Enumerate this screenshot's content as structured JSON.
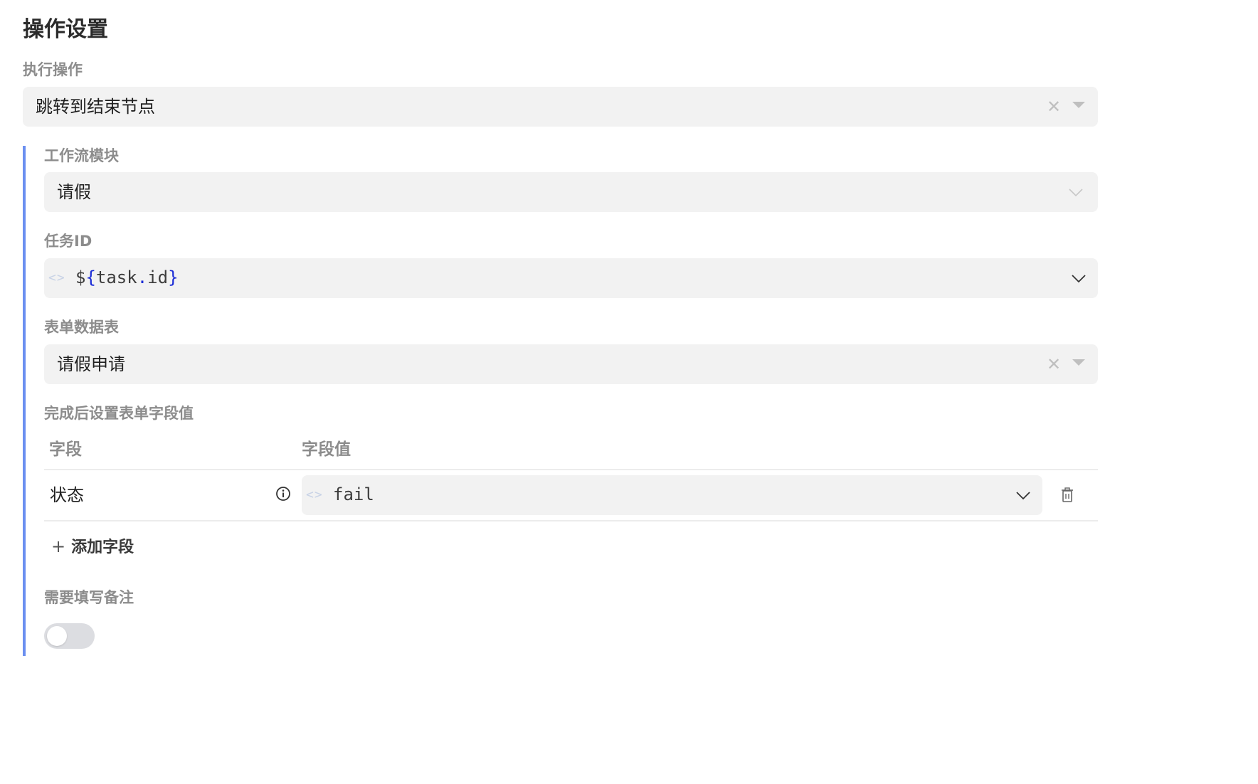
{
  "page_title": "操作设置",
  "action": {
    "label": "执行操作",
    "value": "跳转到结束节点",
    "clear_icon": "close-icon",
    "caret_icon": "caret-down-icon"
  },
  "workflow_module": {
    "label": "工作流模块",
    "value": "请假",
    "chevron_icon": "chevron-down-icon"
  },
  "task_id": {
    "label": "任务ID",
    "prefix_icon": "code-icon",
    "expression": {
      "dollar": "$",
      "open_brace": "{",
      "object": "task",
      "dot": ".",
      "property": "id",
      "close_brace": "}"
    },
    "chevron_icon": "chevron-down-icon"
  },
  "form_table": {
    "label": "表单数据表",
    "value": "请假申请",
    "clear_icon": "close-icon",
    "caret_icon": "caret-down-icon"
  },
  "field_values": {
    "label": "完成后设置表单字段值",
    "columns": [
      "字段",
      "字段值"
    ],
    "rows": [
      {
        "field": "状态",
        "info_icon": "info-icon",
        "value": "fail",
        "value_icon": "code-icon",
        "delete_icon": "trash-icon"
      }
    ],
    "add_label": "添加字段",
    "add_icon": "plus-icon"
  },
  "require_remark": {
    "label": "需要填写备注",
    "enabled": false
  },
  "colors": {
    "accent_bar": "#6b8ff0",
    "field_bg": "#f2f2f2",
    "expression_brace": "#1a2bd6"
  }
}
